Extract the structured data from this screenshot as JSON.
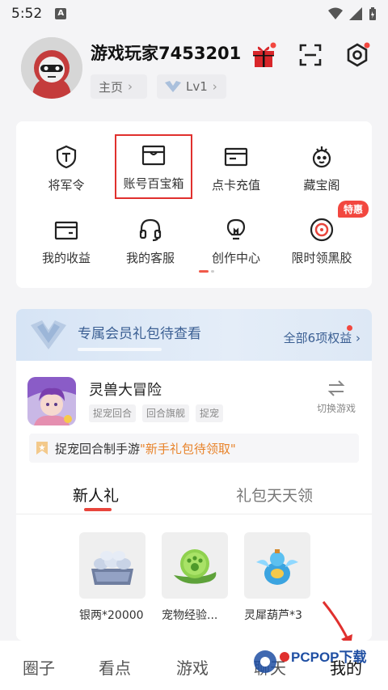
{
  "status_bar": {
    "time": "5:52"
  },
  "profile": {
    "username": "游戏玩家7453201",
    "home_chip": "主页",
    "home_arrow": "›",
    "level_chip": "Lv1",
    "level_arrow": "›"
  },
  "grid": {
    "items": [
      {
        "label": "将军令",
        "icon": "shield-t-icon"
      },
      {
        "label": "账号百宝箱",
        "icon": "treasure-box-icon"
      },
      {
        "label": "点卡充值",
        "icon": "card-recharge-icon"
      },
      {
        "label": "藏宝阁",
        "icon": "treasure-pavilion-icon"
      },
      {
        "label": "我的收益",
        "icon": "wallet-icon"
      },
      {
        "label": "我的客服",
        "icon": "headset-icon"
      },
      {
        "label": "创作中心",
        "icon": "lightbulb-icon"
      },
      {
        "label": "限时领黑胶",
        "icon": "vinyl-icon",
        "badge": "特惠"
      }
    ]
  },
  "vip": {
    "title": "专属会员礼包待查看",
    "all_benefits": "全部6项权益",
    "arrow": "›"
  },
  "game": {
    "name": "灵兽大冒险",
    "tags": [
      "捉宠回合",
      "回合旗舰",
      "捉宠"
    ],
    "switch_label": "切换游戏"
  },
  "notice": {
    "text_prefix": "捉宠回合制手游",
    "text_highlight": "\"新手礼包待领取\""
  },
  "tabs": {
    "active": "新人礼",
    "inactive": "礼包天天领"
  },
  "gifts": [
    {
      "label": "银两*20000"
    },
    {
      "label": "宠物经验..."
    },
    {
      "label": "灵犀葫芦*3"
    }
  ],
  "bottom_nav": {
    "items": [
      "圈子",
      "看点",
      "游戏",
      "聊天",
      "我的"
    ],
    "active_index": 4
  },
  "watermark": {
    "text": "PCPOP下载"
  },
  "colors": {
    "accent_red": "#e8453c",
    "vip_blue": "#3b5f93",
    "highlight_orange": "#e8832a"
  }
}
